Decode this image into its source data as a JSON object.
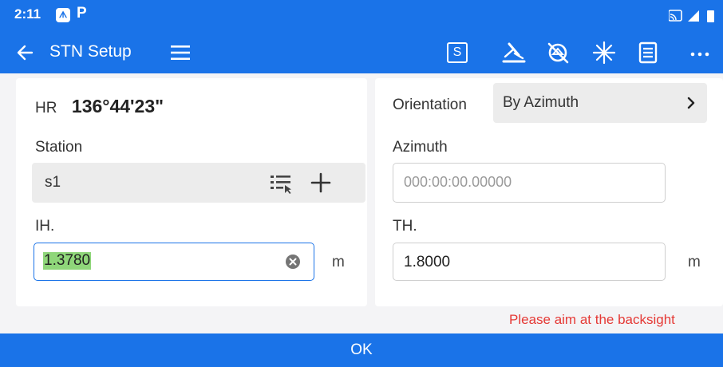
{
  "status_bar": {
    "time": "2:11",
    "app_icon_glyph": "ᗑ",
    "p_icon_glyph": "P",
    "icons": [
      "photo-icon",
      "parking-icon",
      "cast-icon",
      "signal-icon",
      "battery-icon"
    ]
  },
  "app_bar": {
    "title": "STN Setup",
    "s_button_label": "S",
    "toolbar_icons": [
      "back-arrow-icon",
      "menu-icon",
      "s-mode-icon",
      "level-icon",
      "prism-off-icon",
      "laser-icon",
      "settings-list-icon",
      "more-icon"
    ]
  },
  "left": {
    "hr_label": "HR",
    "hr_value": "136°44'23\"",
    "station_label": "Station",
    "station_value": "s1",
    "ih_label": "IH.",
    "ih_value": "1.3780",
    "ih_unit": "m"
  },
  "right": {
    "orientation_label": "Orientation",
    "orientation_value": "By Azimuth",
    "azimuth_label": "Azimuth",
    "azimuth_placeholder": "000:00:00.00000",
    "th_label": "TH.",
    "th_value": "1.8000",
    "th_unit": "m"
  },
  "warning": "Please aim at the backsight",
  "ok_label": "OK",
  "colors": {
    "primary": "#1a73e8",
    "warning": "#e53935",
    "selection": "#8fd67a"
  }
}
